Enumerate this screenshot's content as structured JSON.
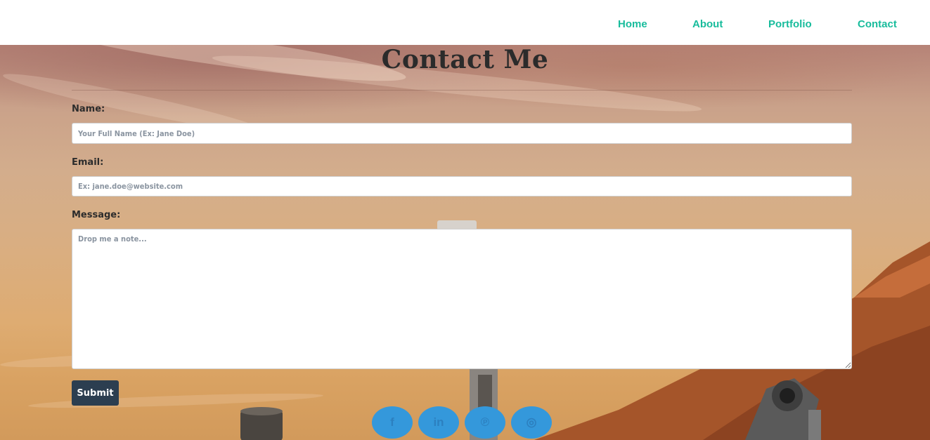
{
  "nav": {
    "items": [
      {
        "label": "Home"
      },
      {
        "label": "About"
      },
      {
        "label": "Portfolio"
      },
      {
        "label": "Contact"
      }
    ]
  },
  "page": {
    "title": "Contact Me"
  },
  "form": {
    "name_label": "Name:",
    "name_placeholder": "Your Full Name (Ex: Jane Doe)",
    "email_label": "Email:",
    "email_placeholder": "Ex: jane.doe@website.com",
    "message_label": "Message:",
    "message_placeholder": "Drop me a note...",
    "submit_label": "Submit"
  },
  "social": [
    {
      "icon": "facebook-icon",
      "glyph": "f"
    },
    {
      "icon": "linkedin-icon",
      "glyph": "in"
    },
    {
      "icon": "pinterest-icon",
      "glyph": "℗"
    },
    {
      "icon": "github-icon",
      "glyph": "◎"
    }
  ],
  "colors": {
    "nav_link": "#18bc9c",
    "submit_bg": "#2c3e50",
    "social_bg": "#3498db"
  }
}
